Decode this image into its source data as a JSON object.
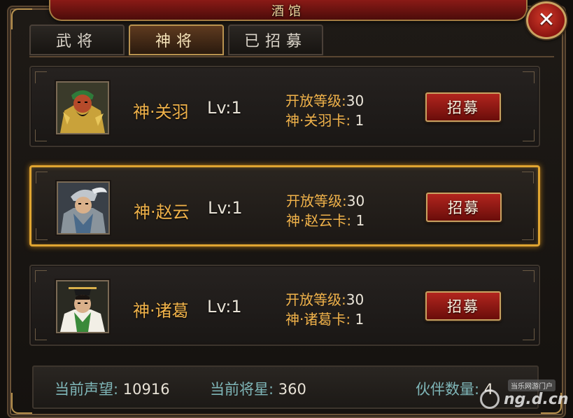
{
  "window": {
    "title": "酒馆"
  },
  "close_button": {
    "label": "✕"
  },
  "tabs": [
    {
      "label": "武将",
      "active": false
    },
    {
      "label": "神将",
      "active": true
    },
    {
      "label": "已招募",
      "active": false
    }
  ],
  "heroes": [
    {
      "name": "神·关羽",
      "level": "Lv:1",
      "open_level_label": "开放等级:",
      "open_level_value": "30",
      "card_label": "神·关羽卡:",
      "card_value": "1",
      "button_label": "招募",
      "selected": false
    },
    {
      "name": "神·赵云",
      "level": "Lv:1",
      "open_level_label": "开放等级:",
      "open_level_value": "30",
      "card_label": "神·赵云卡:",
      "card_value": "1",
      "button_label": "招募",
      "selected": true
    },
    {
      "name": "神·诸葛",
      "level": "Lv:1",
      "open_level_label": "开放等级:",
      "open_level_value": "30",
      "card_label": "神·诸葛卡:",
      "card_value": "1",
      "button_label": "招募",
      "selected": false
    }
  ],
  "footer": {
    "reputation_label": "当前声望:",
    "reputation_value": "10916",
    "general_star_label": "当前将星:",
    "general_star_value": "360",
    "partner_label": "伙伴数量:",
    "partner_value": "4"
  },
  "watermark": {
    "top_text": "当乐网游门户",
    "logo_text": "ng.d.cn"
  },
  "colors": {
    "accent_gold": "#f0b24a",
    "selected_border": "#e0a531",
    "button_red": "#b2251e",
    "footer_label": "#7fb6b8"
  }
}
